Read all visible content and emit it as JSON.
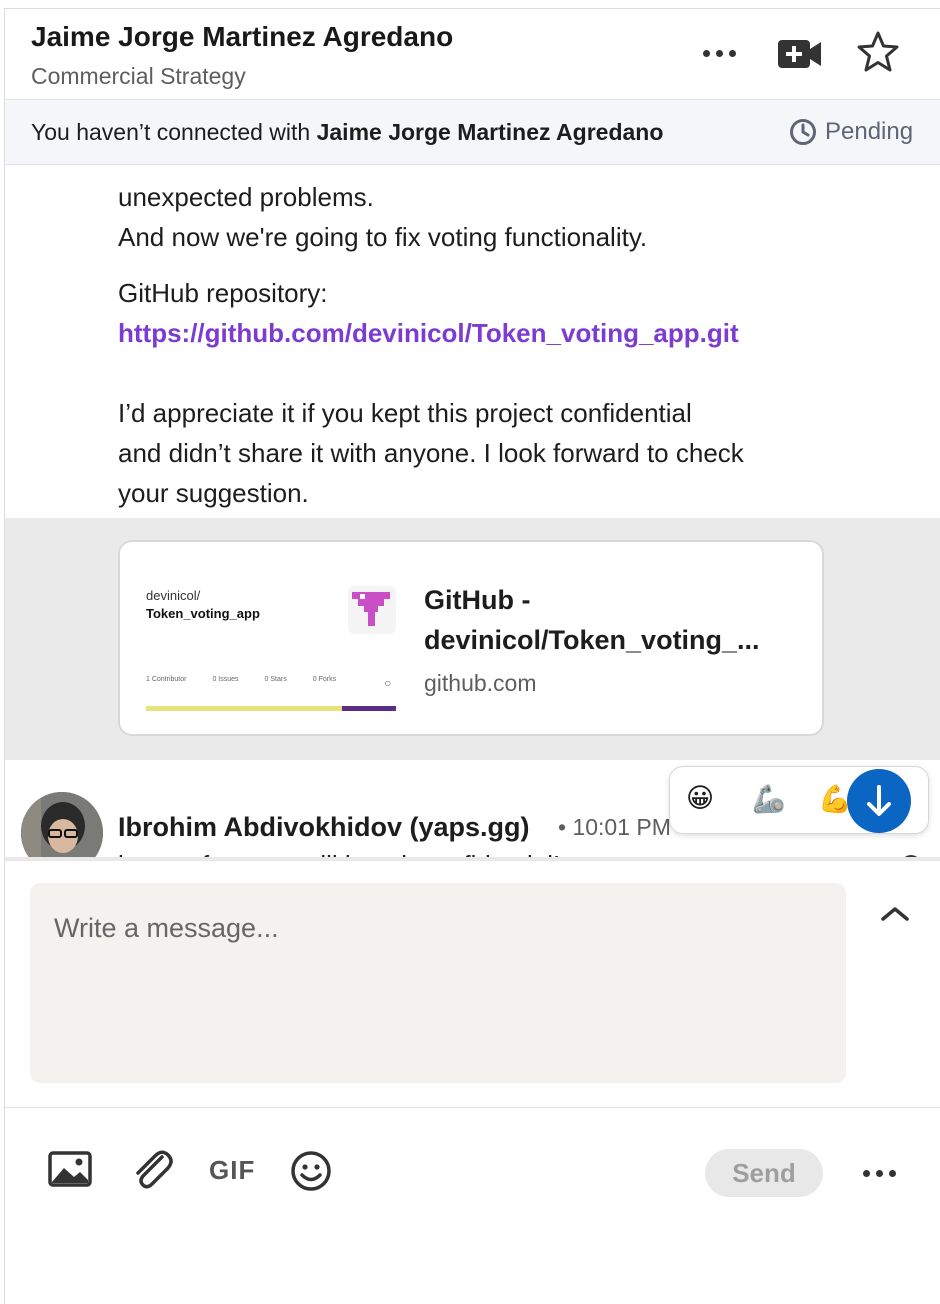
{
  "header": {
    "name": "Jaime Jorge Martinez Agredano",
    "headline": "Commercial Strategy",
    "icons": [
      "more-icon",
      "video-call-icon",
      "star-icon"
    ]
  },
  "banner": {
    "prefix": "You haven’t connected with ",
    "name": "Jaime Jorge Martinez Agredano",
    "status": "Pending"
  },
  "message": {
    "line1": "unexpected problems.",
    "line2": "And now we're going to fix voting functionality.",
    "repo_label": "GitHub repository:",
    "repo_link": "https://github.com/devinicol/Token_voting_app.git",
    "para1": "I’d appreciate it if you kept this project confidential",
    "para2": "and didn’t share it with anyone. I look forward to check",
    "para3": "your suggestion."
  },
  "link_card": {
    "thumb_owner": "devinicol/",
    "thumb_repo": "Token_voting_app",
    "thumb_stats": [
      "1 Contributor",
      "0 Issues",
      "0 Stars",
      "0 Forks"
    ],
    "title_line1": "GitHub -",
    "title_line2": "devinicol/Token_voting_...",
    "domain": "github.com"
  },
  "next_message": {
    "sender": "Ibrohim Abdivokhidov (yaps.gg)",
    "time": "10:01 PM",
    "text_cut": "i see, of course will kept it confidential!"
  },
  "reactions": [
    "😀",
    "🦾",
    "💪"
  ],
  "composer": {
    "placeholder": "Write a message...",
    "gif_label": "GIF",
    "send_label": "Send"
  },
  "colors": {
    "link": "#7c3bd1",
    "accent": "#0a66c2",
    "banner_bg": "#f4f6f9",
    "input_bg": "#f3f2ef"
  }
}
